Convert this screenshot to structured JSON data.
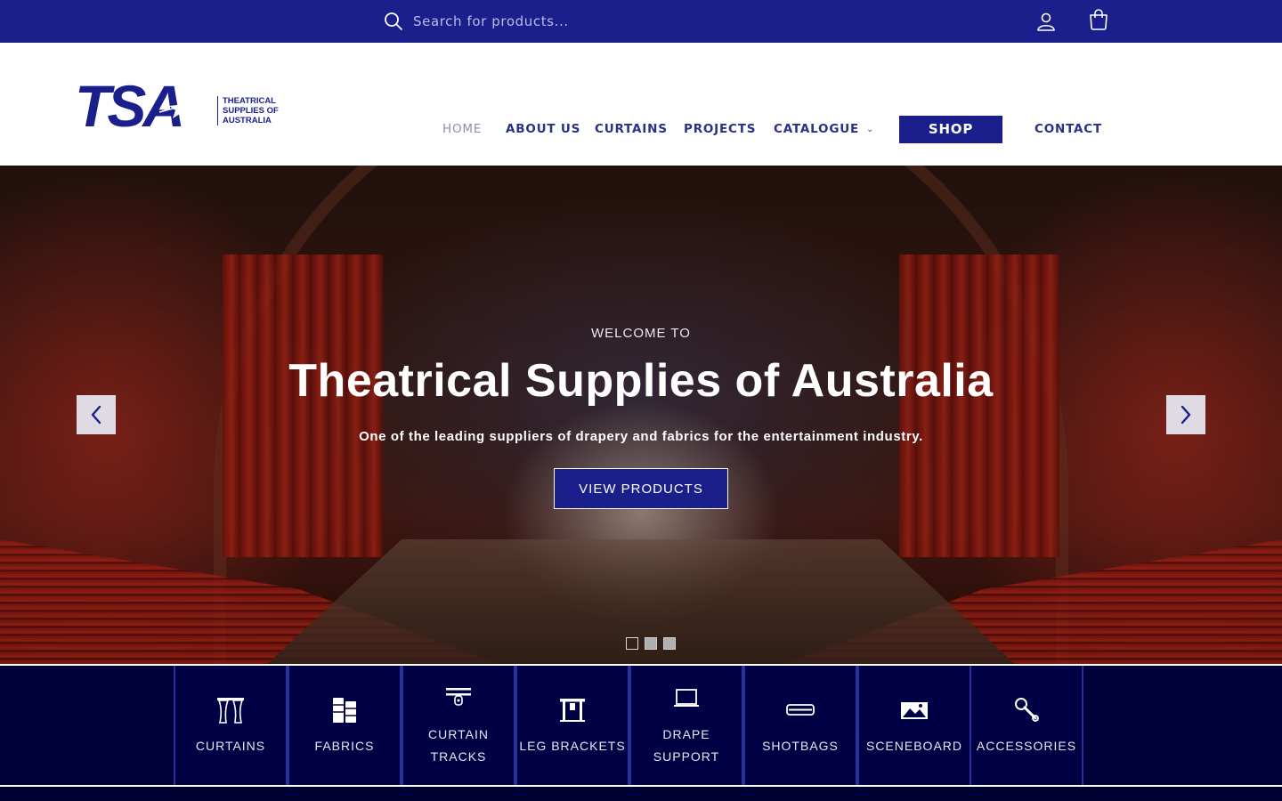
{
  "topbar": {
    "search_placeholder": "Search for products..."
  },
  "logo": {
    "mark": "TSA",
    "tagline_lines": [
      "THEATRICAL",
      "SUPPLIES OF",
      "AUSTRALIA"
    ]
  },
  "nav": {
    "home": "HOME",
    "about": "ABOUT US",
    "curtains": "CURTAINS",
    "projects": "PROJECTS",
    "catalogue": "CATALOGUE",
    "shop": "SHOP",
    "contact": "CONTACT"
  },
  "hero": {
    "eyebrow": "WELCOME TO",
    "title": "Theatrical Supplies of Australia",
    "subtitle": "One of the leading suppliers of drapery and fabrics for the entertainment industry.",
    "button": "VIEW PRODUCTS",
    "slide_count": 3,
    "active_slide": 1
  },
  "categories": [
    {
      "label": "CURTAINS",
      "icon": "curtains-icon"
    },
    {
      "label": "FABRICS",
      "icon": "fabrics-icon"
    },
    {
      "label": "CURTAIN TRACKS",
      "icon": "curtain-track-icon"
    },
    {
      "label": "LEG BRACKETS",
      "icon": "leg-bracket-icon"
    },
    {
      "label": "DRAPE SUPPORT",
      "icon": "drape-support-icon"
    },
    {
      "label": "SHOTBAGS",
      "icon": "shotbag-icon"
    },
    {
      "label": "SCENEBOARD",
      "icon": "sceneboard-icon"
    },
    {
      "label": "ACCESSORIES",
      "icon": "accessories-icon"
    }
  ],
  "colors": {
    "brand_blue": "#1a1f8c",
    "nav_text": "#2a3187",
    "category_bg": "#000044"
  }
}
